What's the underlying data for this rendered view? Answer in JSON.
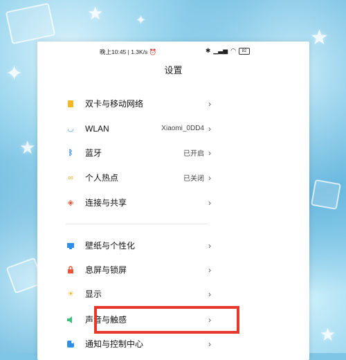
{
  "status_bar": {
    "time_speed": "晚上10:45 | 1.3K/s",
    "alarm_icon": "alarm-icon",
    "battery": "82"
  },
  "page_title": "设置",
  "groups": [
    {
      "items": [
        {
          "label": "双卡与移动网络",
          "value": "",
          "icon": "sim-card-icon",
          "color": "#f5b623"
        },
        {
          "label": "WLAN",
          "value": "Xiaomi_0DD4",
          "icon": "wifi-icon",
          "color": "#3aa0e8"
        },
        {
          "label": "蓝牙",
          "value": "已开启",
          "icon": "bluetooth-icon",
          "color": "#3a86e8"
        },
        {
          "label": "个人热点",
          "value": "已关闭",
          "icon": "hotspot-icon",
          "color": "#f5a623"
        },
        {
          "label": "连接与共享",
          "value": "",
          "icon": "share-icon",
          "color": "#e8553a"
        }
      ]
    },
    {
      "items": [
        {
          "label": "壁纸与个性化",
          "value": "",
          "icon": "wallpaper-icon",
          "color": "#2f8fe8"
        },
        {
          "label": "息屏与锁屏",
          "value": "",
          "icon": "lock-icon",
          "color": "#e8553a"
        },
        {
          "label": "显示",
          "value": "",
          "icon": "brightness-icon",
          "color": "#f5b623"
        },
        {
          "label": "声音与触感",
          "value": "",
          "icon": "speaker-icon",
          "color": "#3ac07a"
        },
        {
          "label": "通知与控制中心",
          "value": "",
          "icon": "notification-icon",
          "color": "#2f8fe8"
        }
      ]
    }
  ],
  "highlight_color": "#e7372a"
}
